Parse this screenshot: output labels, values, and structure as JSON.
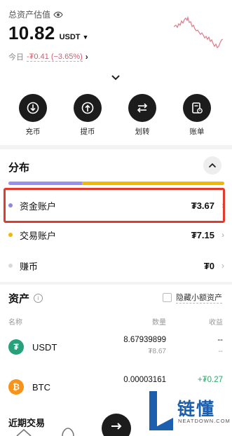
{
  "header": {
    "estimated_label": "总资产估值",
    "amount": "10.82",
    "currency": "USDT",
    "today_label": "今日",
    "today_change": "-₮0.41 (−3.65%)"
  },
  "actions": [
    {
      "label": "充币",
      "icon": "deposit-icon"
    },
    {
      "label": "提币",
      "icon": "withdraw-icon"
    },
    {
      "label": "划转",
      "icon": "transfer-icon"
    },
    {
      "label": "账单",
      "icon": "bill-icon"
    }
  ],
  "distribution": {
    "title": "分布",
    "segments": [
      {
        "account": "资金账户",
        "fraction": 0.34,
        "color": "#9a8ff0"
      },
      {
        "account": "交易账户",
        "fraction": 0.66,
        "color": "#f2b705"
      }
    ],
    "accounts": [
      {
        "name": "资金账户",
        "value": "₮3.67",
        "color": "#8c86e6"
      },
      {
        "name": "交易账户",
        "value": "₮7.15",
        "color": "#f2b705"
      },
      {
        "name": "赚币",
        "value": "₮0",
        "color": "#d9d9d9"
      }
    ]
  },
  "assets": {
    "title": "资产",
    "hide_small_label": "隐藏小额资产",
    "columns": {
      "name": "名称",
      "quantity": "数量",
      "pnl": "收益"
    },
    "rows": [
      {
        "name": "USDT",
        "quantity": "8.67939899",
        "fiat": "₮8.67",
        "pnl": "--",
        "pnl_sub": "--",
        "icon_color": "#26a17b",
        "pnl_color": "#222222"
      },
      {
        "name": "BTC",
        "quantity": "0.00003161",
        "fiat": "",
        "pnl": "+₮0.27",
        "pnl_sub": "",
        "icon_color": "#f7931a",
        "pnl_color": "#2aa86a"
      }
    ]
  },
  "recent": {
    "title": "近期交易"
  },
  "watermark": {
    "text": "链懂",
    "sub": "NEATDOWN.COM"
  }
}
